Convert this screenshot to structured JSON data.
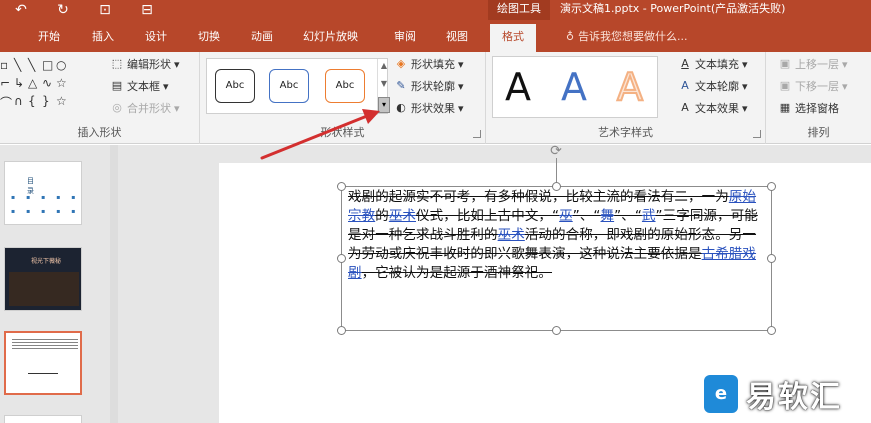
{
  "titlebar": {
    "context_tab_label": "绘图工具",
    "document_title": "演示文稿1.pptx - PowerPoint(产品激活失败)",
    "qat_icons": [
      "undo-icon",
      "redo-icon",
      "record-icon",
      "start-slideshow-icon"
    ]
  },
  "tabs": [
    {
      "label": "开始"
    },
    {
      "label": "插入"
    },
    {
      "label": "设计"
    },
    {
      "label": "切换"
    },
    {
      "label": "动画"
    },
    {
      "label": "幻灯片放映"
    },
    {
      "label": "审阅"
    },
    {
      "label": "视图"
    },
    {
      "label": "格式",
      "active": true
    }
  ],
  "tell_me": {
    "placeholder": "告诉我您想要做什么..."
  },
  "ribbon": {
    "insert_shapes": {
      "label": "插入形状",
      "edit_shape": "编辑形状",
      "text_box": "文本框",
      "merge_shapes": "合并形状"
    },
    "shape_styles": {
      "label": "形状样式",
      "swatches": [
        {
          "text": "Abc",
          "border": "#333333"
        },
        {
          "text": "Abc",
          "border": "#4472c4"
        },
        {
          "text": "Abc",
          "border": "#ed7d31"
        }
      ],
      "fill": "形状填充",
      "outline": "形状轮廓",
      "effects": "形状效果"
    },
    "wordart_styles": {
      "label": "艺术字样式",
      "letters": [
        {
          "char": "A",
          "color": "#111111"
        },
        {
          "char": "A",
          "color": "#4472c4"
        },
        {
          "char": "A",
          "color": "#f4b183"
        }
      ],
      "text_fill": "文本填充",
      "text_outline": "文本轮廓",
      "text_effects": "文本效果"
    },
    "arrange": {
      "label": "排列",
      "bring_forward": "上移一层",
      "send_backward": "下移一层",
      "selection_pane": "选择窗格"
    }
  },
  "slides": [
    {
      "kind": "agenda",
      "text": "目 录"
    },
    {
      "kind": "dark-photo",
      "text": "视光下薇秘"
    },
    {
      "kind": "text",
      "selected": true
    }
  ],
  "textbox": {
    "segments": [
      {
        "text": "戏剧的起源实不可考，有多种假说，比较主流的看法有二，一为",
        "link": false
      },
      {
        "text": "原始宗教",
        "link": true
      },
      {
        "text": "的",
        "link": false
      },
      {
        "text": "巫术",
        "link": true
      },
      {
        "text": "仪式，比如上古中文，“",
        "link": false
      },
      {
        "text": "巫",
        "link": true
      },
      {
        "text": "”、“",
        "link": false
      },
      {
        "text": "舞",
        "link": true
      },
      {
        "text": "”、“",
        "link": false
      },
      {
        "text": "武",
        "link": true
      },
      {
        "text": "”三字同源，可能是对一种乞求战斗胜利的",
        "link": false
      },
      {
        "text": "巫术",
        "link": true
      },
      {
        "text": "活动的合称，即戏剧的原始形态。另一为劳动或庆祝丰收时的即兴歌舞表演，这种说法主要依据是",
        "link": false
      },
      {
        "text": "古希腊戏剧",
        "link": true
      },
      {
        "text": "，它被认为是起源于酒神祭祀。",
        "link": false
      }
    ]
  },
  "watermark": {
    "text": "易软汇"
  },
  "colors": {
    "accent": "#b7472a",
    "link": "#2a52be",
    "annotation_arrow": "#d32f2f"
  }
}
